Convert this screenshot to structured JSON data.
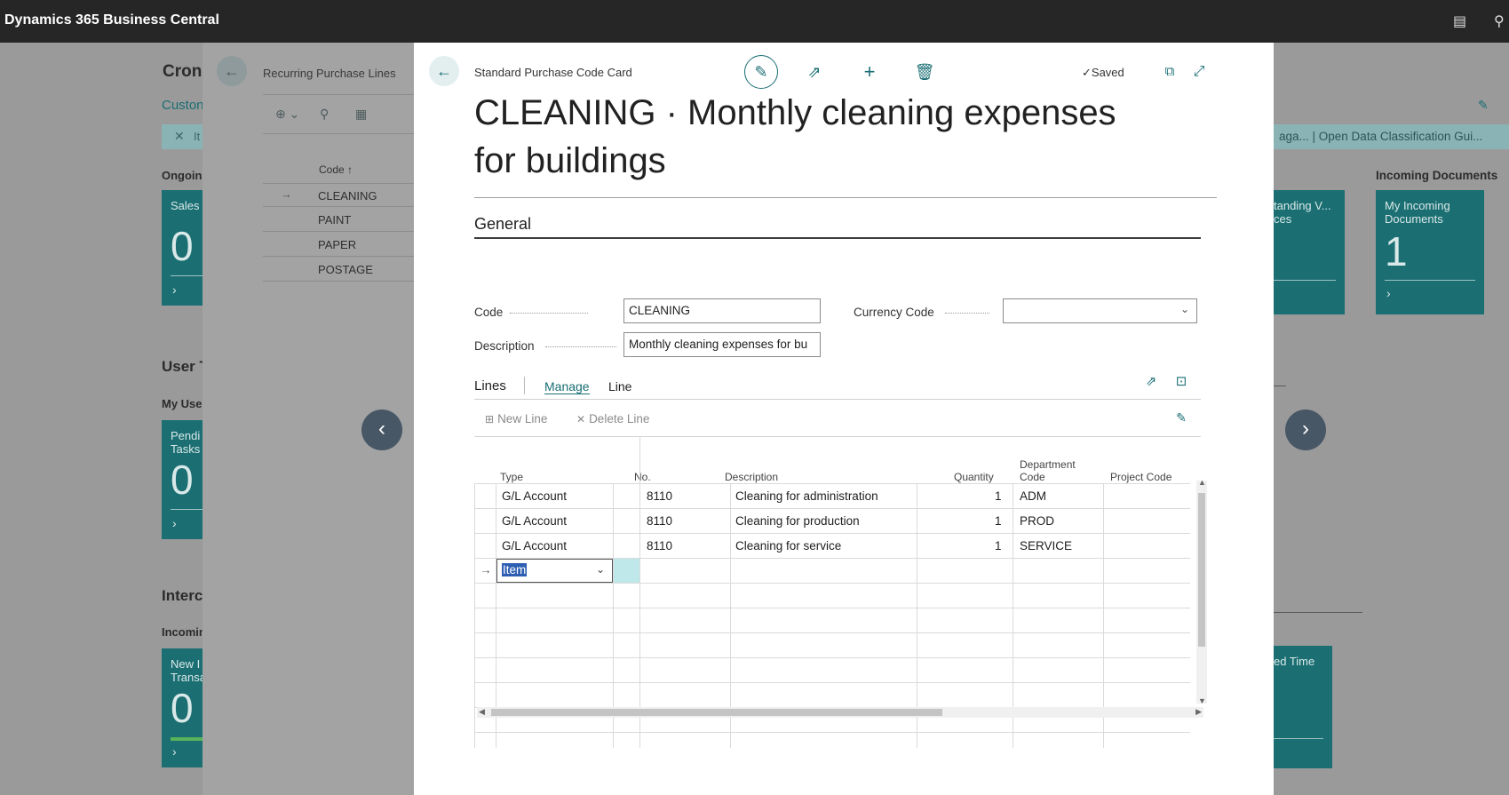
{
  "app": {
    "title": "Dynamics 365 Business Central"
  },
  "background": {
    "page_title": "Cron",
    "customer_link": "Custon",
    "filter_x": "It",
    "filter_right": "aga... | Open Data Classification Gui...",
    "ongoing": "Ongoin",
    "sales_tile": "Sales",
    "sales_value": "0",
    "user_tasks": "User T",
    "my_user": "My Use",
    "pending_tile": "Pendi Tasks",
    "pending_value": "0",
    "intercompany": "Interc",
    "incoming": "Incomin",
    "new_tile": "New I Transa",
    "new_value": "0",
    "outstanding_tile": "tanding V... ces",
    "incoming_docs_header": "Incoming Documents",
    "my_incoming_tile": "My Incoming Documents",
    "my_incoming_value": "1",
    "time_tile": "ed Time"
  },
  "recurring": {
    "title": "Recurring Purchase Lines",
    "col_code": "Code ↑",
    "rows": [
      "CLEANING",
      "PAINT",
      "PAPER",
      "POSTAGE"
    ]
  },
  "card": {
    "name": "Standard Purchase Code Card",
    "saved": "Saved",
    "title": "CLEANING · Monthly cleaning expenses for buildings",
    "general": "General",
    "code_label": "Code",
    "code_value": "CLEANING",
    "description_label": "Description",
    "description_value": "Monthly cleaning expenses for bu",
    "currency_label": "Currency Code",
    "currency_value": ""
  },
  "lines": {
    "title": "Lines",
    "tab_manage": "Manage",
    "tab_line": "Line",
    "new_line": "New Line",
    "delete_line": "Delete Line",
    "headers": {
      "type": "Type",
      "no": "No.",
      "description": "Description",
      "quantity": "Quantity",
      "department": "Department Code",
      "project": "Project Code"
    },
    "rows": [
      {
        "type": "G/L Account",
        "no": "8110",
        "description": "Cleaning for administration",
        "quantity": "1",
        "department": "ADM"
      },
      {
        "type": "G/L Account",
        "no": "8110",
        "description": "Cleaning for production",
        "quantity": "1",
        "department": "PROD"
      },
      {
        "type": "G/L Account",
        "no": "8110",
        "description": "Cleaning for service",
        "quantity": "1",
        "department": "SERVICE"
      }
    ],
    "new_row_type": "Item"
  },
  "colors": {
    "accent": "#1a6e74",
    "tile": "#1b6f73",
    "appbar": "#262626"
  }
}
